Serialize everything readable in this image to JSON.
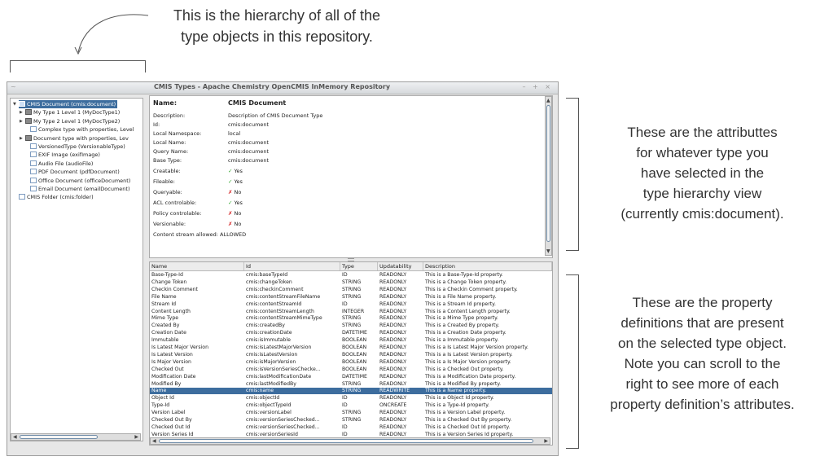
{
  "annotations": {
    "top": [
      "This is the hierarchy of all of the",
      "type objects in this repository."
    ],
    "attributes": [
      "These are the attributtes",
      "for whatever type you",
      "have selected in the",
      "type hierarchy view",
      "(currently cmis:document)."
    ],
    "properties": [
      "These are the property",
      "definitions that are present",
      "on the selected type object.",
      "Note you can scroll to the",
      "right to see more of each",
      "property definition’s attributes."
    ]
  },
  "window": {
    "title": "CMIS Types - Apache Chemistry OpenCMIS InMemory Repository",
    "menu_icon": "~",
    "controls": "– + ×"
  },
  "tree": [
    {
      "label": "CMIS Document (cmis:document)",
      "icon": "folder-icon",
      "expander": "▼",
      "selected": true
    },
    {
      "label": "My Type 1 Level 1 (MyDocType1)",
      "icon": "folder-icon",
      "expander": "▶"
    },
    {
      "label": "My Type 2 Level 1 (MyDocType2)",
      "icon": "folder-icon",
      "expander": "▶"
    },
    {
      "label": "Complex type with properties, Level",
      "icon": "document-icon",
      "expander": ""
    },
    {
      "label": "Document type with properties, Lev",
      "icon": "folder-icon",
      "expander": "▶"
    },
    {
      "label": "VersionedType (VersionableType)",
      "icon": "document-icon",
      "expander": ""
    },
    {
      "label": "EXIF Image (exifImage)",
      "icon": "document-icon",
      "expander": ""
    },
    {
      "label": "Audio File (audioFile)",
      "icon": "document-icon",
      "expander": ""
    },
    {
      "label": "PDF Document (pdfDocument)",
      "icon": "document-icon",
      "expander": ""
    },
    {
      "label": "Office Document (officeDocument)",
      "icon": "document-icon",
      "expander": ""
    },
    {
      "label": "Email Document (emailDocument)",
      "icon": "document-icon",
      "expander": ""
    },
    {
      "label": "CMIS Folder (cmis:folder)",
      "icon": "document-icon",
      "expander": ""
    }
  ],
  "details": [
    {
      "label": "Name:",
      "value": "CMIS Document",
      "heading": true
    },
    {
      "label": "Description:",
      "value": "Description of CMIS Document Type"
    },
    {
      "label": "Id:",
      "value": "cmis:document"
    },
    {
      "label": "Local Namespace:",
      "value": "local"
    },
    {
      "label": "Local Name:",
      "value": "cmis:document"
    },
    {
      "label": "Query Name:",
      "value": "cmis:document"
    },
    {
      "label": "Base Type:",
      "value": "cmis:document"
    },
    {
      "label": "Creatable:",
      "value": "Yes",
      "mark": "✓"
    },
    {
      "label": "Fileable:",
      "value": "Yes",
      "mark": "✓"
    },
    {
      "label": "Queryable:",
      "value": "No",
      "mark": "✗"
    },
    {
      "label": "ACL controlable:",
      "value": "Yes",
      "mark": "✓"
    },
    {
      "label": "Policy controlable:",
      "value": "No",
      "mark": "✗"
    },
    {
      "label": "Versionable:",
      "value": "No",
      "mark": "✗"
    },
    {
      "label": "Content stream allowed:",
      "value": "ALLOWED"
    }
  ],
  "table": {
    "columns": [
      "Name",
      "Id",
      "Type",
      "Updatability",
      "Description"
    ],
    "rows": [
      [
        "Base-Type-Id",
        "cmis:baseTypeId",
        "ID",
        "READONLY",
        "This is a Base-Type-Id property."
      ],
      [
        "Change Token",
        "cmis:changeToken",
        "STRING",
        "READONLY",
        "This is a Change Token property."
      ],
      [
        "Checkin Comment",
        "cmis:checkinComment",
        "STRING",
        "READONLY",
        "This is a Checkin Comment property."
      ],
      [
        "File Name",
        "cmis:contentStreamFileName",
        "STRING",
        "READONLY",
        "This is a File Name property."
      ],
      [
        "Stream Id",
        "cmis:contentStreamId",
        "ID",
        "READONLY",
        "This is a Stream Id property."
      ],
      [
        "Content Length",
        "cmis:contentStreamLength",
        "INTEGER",
        "READONLY",
        "This is a Content Length property."
      ],
      [
        "Mime Type",
        "cmis:contentStreamMimeType",
        "STRING",
        "READONLY",
        "This is a Mime Type property."
      ],
      [
        "Created By",
        "cmis:createdBy",
        "STRING",
        "READONLY",
        "This is a Created By property."
      ],
      [
        "Creation Date",
        "cmis:creationDate",
        "DATETIME",
        "READONLY",
        "This is a Creation Date property."
      ],
      [
        "Immutable",
        "cmis:isImmutable",
        "BOOLEAN",
        "READONLY",
        "This is a Immutable property."
      ],
      [
        "Is Latest Major Version",
        "cmis:isLatestMajorVersion",
        "BOOLEAN",
        "READONLY",
        "This is a Is Latest Major Version property."
      ],
      [
        "Is Latest Version",
        "cmis:isLatestVersion",
        "BOOLEAN",
        "READONLY",
        "This is a Is Latest Version property."
      ],
      [
        "Is Major Version",
        "cmis:isMajorVersion",
        "BOOLEAN",
        "READONLY",
        "This is a Is Major Version property."
      ],
      [
        "Checked Out",
        "cmis:isVersionSeriesChecke...",
        "BOOLEAN",
        "READONLY",
        "This is a Checked Out property."
      ],
      [
        "Modification Date",
        "cmis:lastModificationDate",
        "DATETIME",
        "READONLY",
        "This is a Modification Date property."
      ],
      [
        "Modified By",
        "cmis:lastModifiedBy",
        "STRING",
        "READONLY",
        "This is a Modified By property."
      ],
      [
        "Name",
        "cmis:name",
        "STRING",
        "READWRITE",
        "This is a Name property."
      ],
      [
        "Object Id",
        "cmis:objectId",
        "ID",
        "READONLY",
        "This is a Object Id property."
      ],
      [
        "Type-Id",
        "cmis:objectTypeId",
        "ID",
        "ONCREATE",
        "This is a Type-Id property."
      ],
      [
        "Version Label",
        "cmis:versionLabel",
        "STRING",
        "READONLY",
        "This is a Version Label property."
      ],
      [
        "Checked Out By",
        "cmis:versionSeriesChecked...",
        "STRING",
        "READONLY",
        "This is a Checked Out By property."
      ],
      [
        "Checked Out Id",
        "cmis:versionSeriesChecked...",
        "ID",
        "READONLY",
        "This is a Checked Out Id property."
      ],
      [
        "Version Series Id",
        "cmis:versionSeriesId",
        "ID",
        "READONLY",
        "This is a Version Series Id property."
      ]
    ],
    "selected_row": 16
  },
  "scroll": {
    "left": "◀",
    "right": "▶",
    "up": "▲",
    "down": "▼"
  },
  "colors": {
    "selection": "#3d6d9e",
    "check": "#3cac37",
    "cross": "#d42020"
  }
}
